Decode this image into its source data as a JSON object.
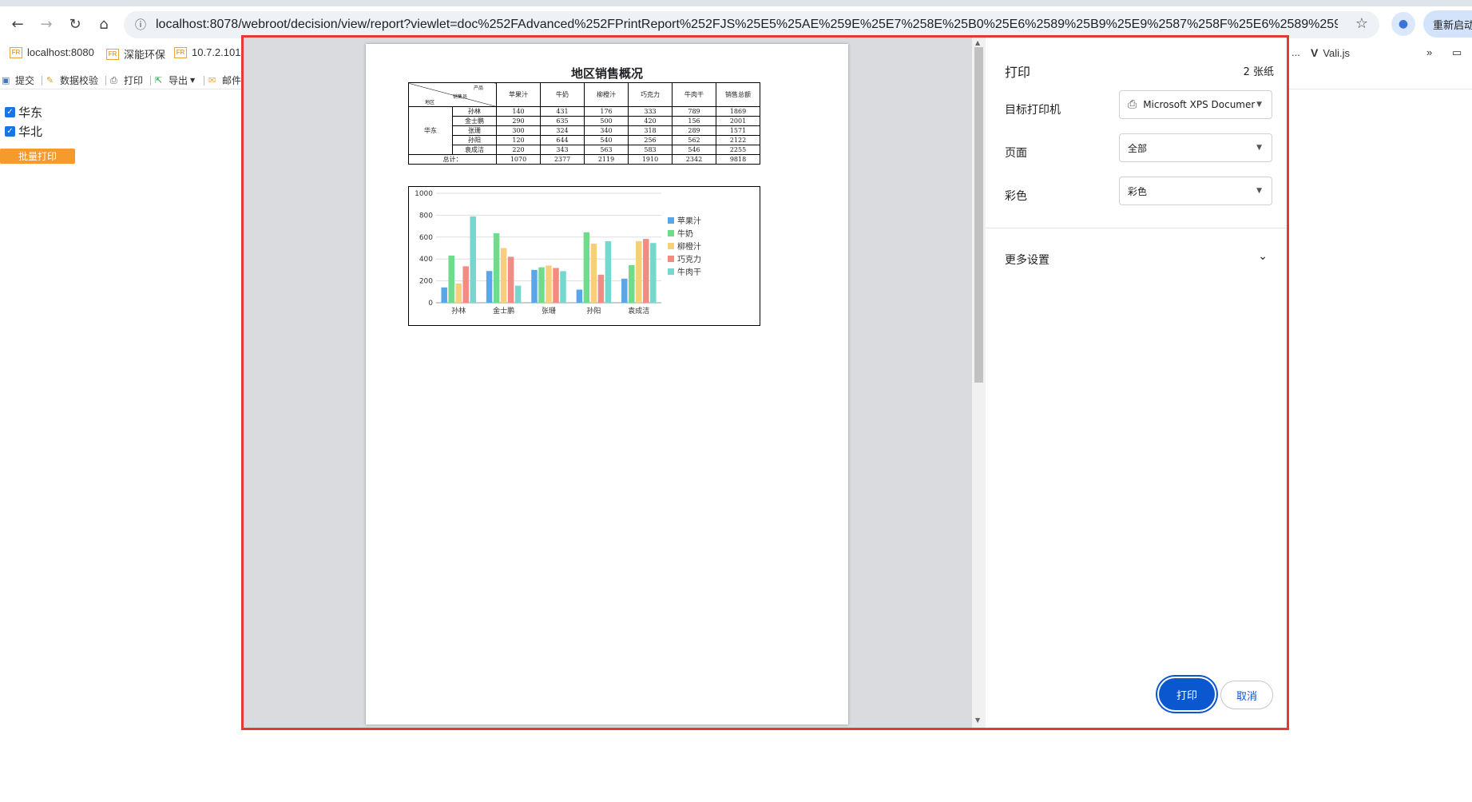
{
  "browser": {
    "url": "localhost:8078/webroot/decision/view/report?viewlet=doc%252FAdvanced%252FPrintReport%252FJS%25E5%25AE%259E%25E7%258E%25B0%25E6%2589%25B9%25E9%2587%258F%25E6%2589%2593%25E5%258D%25...",
    "restart_label": "重新启动更",
    "bookmarks": [
      "localhost:8080",
      "深能环保",
      "10.7.2.101"
    ],
    "bookmarks_right": [
      "...",
      "Vali.js",
      "»"
    ]
  },
  "toolbar": {
    "submit": "提交",
    "validate": "数据校验",
    "print": "打印",
    "export": "导出",
    "mail": "邮件"
  },
  "filters": [
    {
      "label": "华东",
      "checked": true
    },
    {
      "label": "华北",
      "checked": true
    }
  ],
  "batch_print_label": "批量打印",
  "dialog": {
    "title": "打印",
    "sheet_count": "2 张纸",
    "printer_label": "目标打印机",
    "printer_value": "Microsoft XPS Documer",
    "pages_label": "页面",
    "pages_value": "全部",
    "color_label": "彩色",
    "color_value": "彩色",
    "more_settings": "更多设置",
    "print_button": "打印",
    "cancel_button": "取消"
  },
  "report": {
    "title": "地区销售概况",
    "corner_product": "产品",
    "corner_seller": "销售员",
    "corner_region": "地区",
    "region": "华东",
    "total_label": "总计：",
    "columns": [
      "苹果汁",
      "牛奶",
      "柳橙汁",
      "巧克力",
      "牛肉干",
      "销售总额"
    ],
    "rows": [
      {
        "name": "孙林",
        "values": [
          "140",
          "431",
          "176",
          "333",
          "789",
          "1869"
        ]
      },
      {
        "name": "金士鹏",
        "values": [
          "290",
          "635",
          "500",
          "420",
          "156",
          "2001"
        ]
      },
      {
        "name": "张珊",
        "values": [
          "300",
          "324",
          "340",
          "318",
          "289",
          "1571"
        ]
      },
      {
        "name": "孙阳",
        "values": [
          "120",
          "644",
          "540",
          "256",
          "562",
          "2122"
        ]
      },
      {
        "name": "袁成洁",
        "values": [
          "220",
          "343",
          "563",
          "583",
          "546",
          "2255"
        ]
      }
    ],
    "totals": [
      "1070",
      "2377",
      "2119",
      "1910",
      "2342",
      "9818"
    ]
  },
  "chart_data": {
    "type": "bar",
    "categories": [
      "孙林",
      "金士鹏",
      "张珊",
      "孙阳",
      "袁成洁"
    ],
    "series": [
      {
        "name": "苹果汁",
        "color": "#5ba6e8",
        "values": [
          140,
          290,
          300,
          120,
          220
        ]
      },
      {
        "name": "牛奶",
        "color": "#6fdc8c",
        "values": [
          431,
          635,
          324,
          644,
          343
        ]
      },
      {
        "name": "柳橙汁",
        "color": "#f7cf7a",
        "values": [
          176,
          500,
          340,
          540,
          563
        ]
      },
      {
        "name": "巧克力",
        "color": "#f28b82",
        "values": [
          333,
          420,
          318,
          256,
          583
        ]
      },
      {
        "name": "牛肉干",
        "color": "#76d7cf",
        "values": [
          789,
          156,
          289,
          562,
          546
        ]
      }
    ],
    "yticks": [
      "0",
      "200",
      "400",
      "600",
      "800",
      "1000"
    ],
    "ylim": [
      0,
      1000
    ],
    "grid": true,
    "legend": "right"
  }
}
